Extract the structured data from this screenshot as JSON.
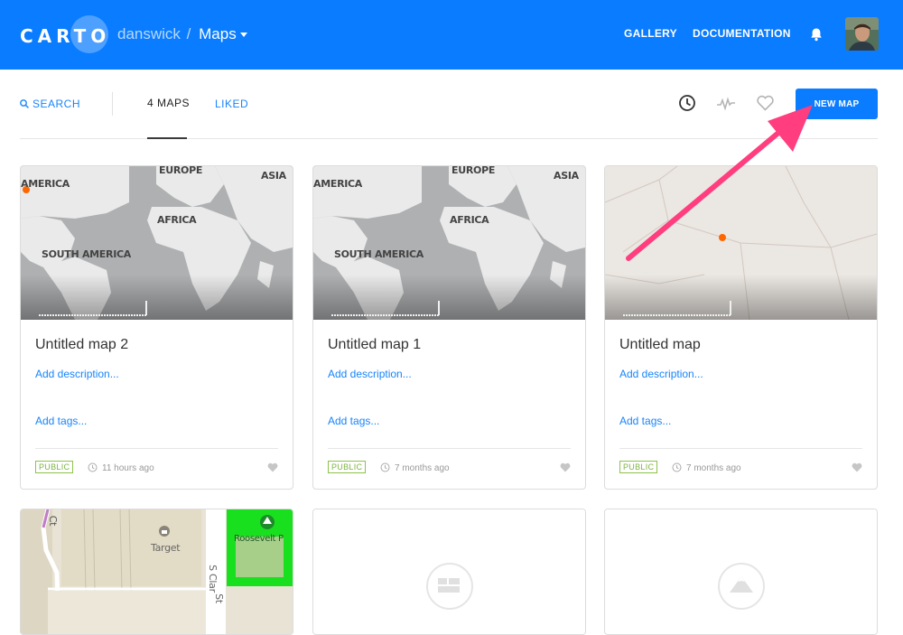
{
  "header": {
    "logo": "CARTO",
    "user": "danswick",
    "separator": "/",
    "section": "Maps",
    "nav": [
      "GALLERY",
      "DOCUMENTATION"
    ]
  },
  "subnav": {
    "search_label": "SEARCH",
    "tab_maps": "4 MAPS",
    "tab_liked": "LIKED",
    "new_map_label": "NEW MAP"
  },
  "map_labels": {
    "europe": "EUROPE",
    "asia": "ASIA",
    "america": "AMERICA",
    "africa": "AFRICA",
    "south_america": "SOUTH AMERICA",
    "target": "Target",
    "roosevelt": "Roosevelt P",
    "clark": "S Clar",
    "st": "St",
    "ct": "Ct"
  },
  "cards": [
    {
      "title": "Untitled map 2",
      "add_description": "Add description...",
      "add_tags": "Add tags...",
      "privacy": "PUBLIC",
      "updated": "11 hours ago"
    },
    {
      "title": "Untitled map 1",
      "add_description": "Add description...",
      "add_tags": "Add tags...",
      "privacy": "PUBLIC",
      "updated": "7 months ago"
    },
    {
      "title": "Untitled map",
      "add_description": "Add description...",
      "add_tags": "Add tags...",
      "privacy": "PUBLIC",
      "updated": "7 months ago"
    }
  ],
  "colors": {
    "brand_blue": "#0a7cff",
    "link_blue": "#1785fb",
    "public_green": "#8bc34a",
    "annotation_pink": "#ff3d7f",
    "point_orange": "#ff6600"
  },
  "icons": [
    "search-icon",
    "bell-icon",
    "clock-icon",
    "activity-icon",
    "heart-icon",
    "building-icon",
    "mountain-icon"
  ]
}
